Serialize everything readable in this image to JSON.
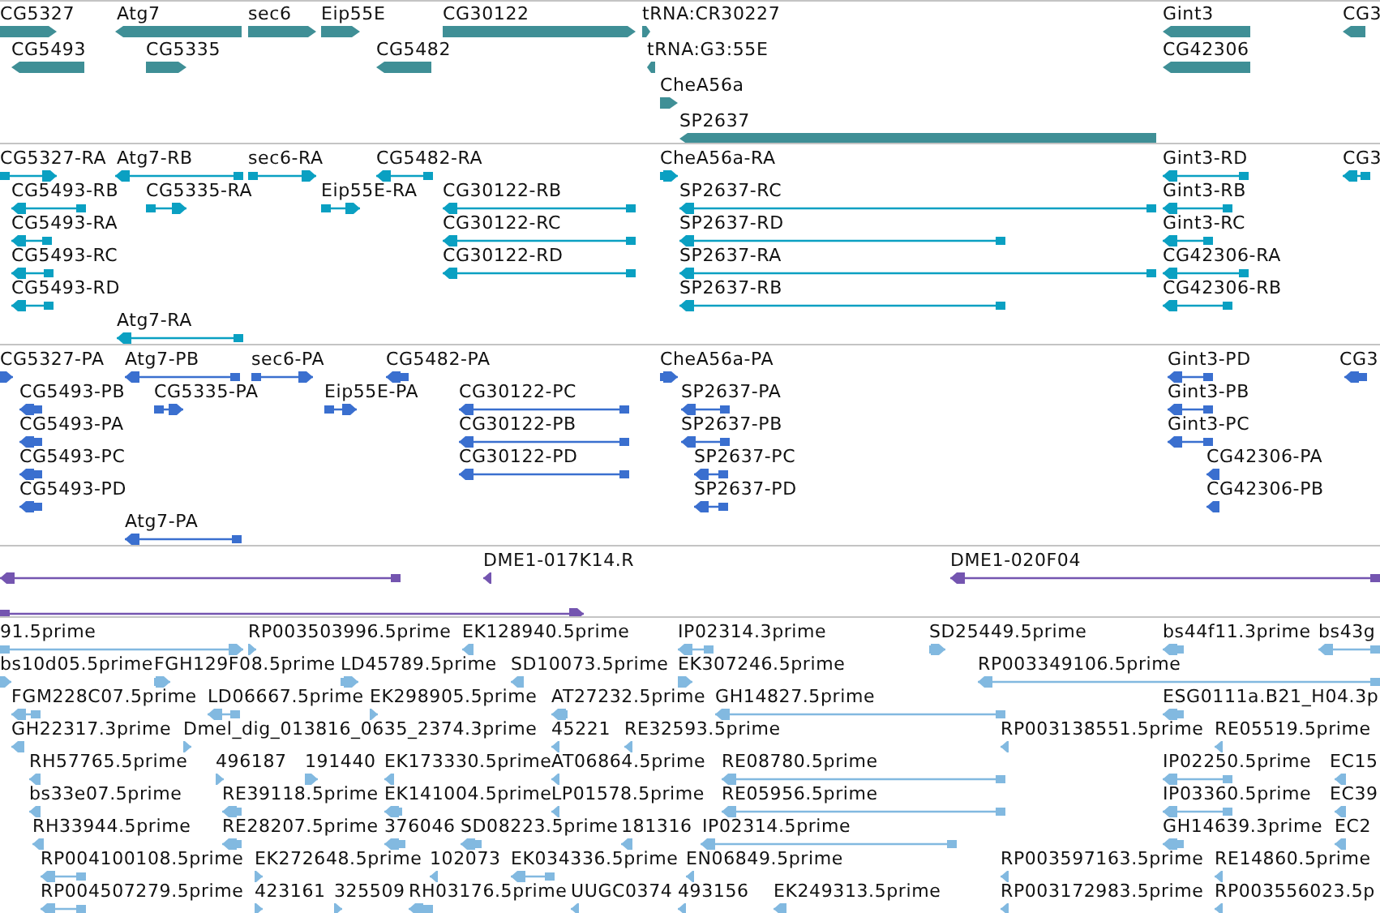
{
  "tracks": [
    {
      "kind": "genes",
      "features": [
        {
          "label": "CG5327",
          "reverse": false
        },
        {
          "label": "Atg7",
          "reverse": true
        },
        {
          "label": "sec6",
          "reverse": false
        },
        {
          "label": "Eip55E",
          "reverse": false
        },
        {
          "label": "CG30122",
          "reverse": false
        },
        {
          "label": "tRNA:CR30227",
          "reverse": false
        },
        {
          "label": "Gint3",
          "reverse": true
        },
        {
          "label": "CG3",
          "reverse": true
        },
        {
          "label": "CG5493",
          "reverse": true
        },
        {
          "label": "CG5335",
          "reverse": false
        },
        {
          "label": "CG5482",
          "reverse": true
        },
        {
          "label": "tRNA:G3:55E",
          "reverse": true
        },
        {
          "label": "CG42306",
          "reverse": true
        },
        {
          "label": "CheA56a",
          "reverse": false
        },
        {
          "label": "SP2637",
          "reverse": true
        }
      ]
    },
    {
      "kind": "transcripts",
      "features": [
        {
          "label": "CG5327-RA",
          "reverse": false
        },
        {
          "label": "Atg7-RB",
          "reverse": true
        },
        {
          "label": "sec6-RA",
          "reverse": false
        },
        {
          "label": "CG5482-RA",
          "reverse": true
        },
        {
          "label": "CheA56a-RA",
          "reverse": false
        },
        {
          "label": "Gint3-RD",
          "reverse": true
        },
        {
          "label": "CG3",
          "reverse": true
        },
        {
          "label": "CG5493-RB",
          "reverse": true
        },
        {
          "label": "CG5335-RA",
          "reverse": false
        },
        {
          "label": "Eip55E-RA",
          "reverse": false
        },
        {
          "label": "CG30122-RB",
          "reverse": true
        },
        {
          "label": "SP2637-RC",
          "reverse": true
        },
        {
          "label": "Gint3-RB",
          "reverse": true
        },
        {
          "label": "CG5493-RA",
          "reverse": true
        },
        {
          "label": "CG30122-RC",
          "reverse": true
        },
        {
          "label": "SP2637-RD",
          "reverse": true
        },
        {
          "label": "Gint3-RC",
          "reverse": true
        },
        {
          "label": "CG5493-RC",
          "reverse": true
        },
        {
          "label": "CG30122-RD",
          "reverse": true
        },
        {
          "label": "SP2637-RA",
          "reverse": true
        },
        {
          "label": "CG42306-RA",
          "reverse": true
        },
        {
          "label": "CG5493-RD",
          "reverse": true
        },
        {
          "label": "SP2637-RB",
          "reverse": true
        },
        {
          "label": "CG42306-RB",
          "reverse": true
        },
        {
          "label": "Atg7-RA",
          "reverse": true
        }
      ]
    },
    {
      "kind": "proteins",
      "features": [
        {
          "label": "CG5327-PA",
          "reverse": false
        },
        {
          "label": "Atg7-PB",
          "reverse": true
        },
        {
          "label": "sec6-PA",
          "reverse": false
        },
        {
          "label": "CG5482-PA",
          "reverse": true
        },
        {
          "label": "CheA56a-PA",
          "reverse": false
        },
        {
          "label": "Gint3-PD",
          "reverse": true
        },
        {
          "label": "CG3",
          "reverse": true
        },
        {
          "label": "CG5493-PB",
          "reverse": true
        },
        {
          "label": "CG5335-PA",
          "reverse": false
        },
        {
          "label": "Eip55E-PA",
          "reverse": false
        },
        {
          "label": "CG30122-PC",
          "reverse": true
        },
        {
          "label": "SP2637-PA",
          "reverse": true
        },
        {
          "label": "Gint3-PB",
          "reverse": true
        },
        {
          "label": "CG5493-PA",
          "reverse": true
        },
        {
          "label": "CG30122-PB",
          "reverse": true
        },
        {
          "label": "SP2637-PB",
          "reverse": true
        },
        {
          "label": "Gint3-PC",
          "reverse": true
        },
        {
          "label": "CG5493-PC",
          "reverse": true
        },
        {
          "label": "CG30122-PD",
          "reverse": true
        },
        {
          "label": "SP2637-PC",
          "reverse": true
        },
        {
          "label": "CG42306-PA",
          "reverse": true
        },
        {
          "label": "CG5493-PD",
          "reverse": true
        },
        {
          "label": "SP2637-PD",
          "reverse": true
        },
        {
          "label": "CG42306-PB",
          "reverse": true
        },
        {
          "label": "Atg7-PA",
          "reverse": true
        }
      ]
    },
    {
      "kind": "clones",
      "features": [
        {
          "reverse": true
        },
        {
          "label": "DME1-017K14.R",
          "reverse": true
        },
        {
          "label": "DME1-020F04",
          "reverse": true
        },
        {
          "reverse": false
        }
      ]
    },
    {
      "kind": "ests",
      "features": [
        {
          "label": "91.5prime",
          "reverse": false
        },
        {
          "label": "RP003503996.5prime",
          "reverse": false
        },
        {
          "label": "EK128940.5prime",
          "reverse": true
        },
        {
          "label": "IP02314.3prime",
          "reverse": true
        },
        {
          "label": "SD25449.5prime",
          "reverse": false
        },
        {
          "label": "bs44f11.3prime",
          "reverse": true
        },
        {
          "label": "bs43g",
          "reverse": true
        },
        {
          "label": "bs10d05.5prime",
          "reverse": false
        },
        {
          "label": "FGH129F08.5prime",
          "reverse": false
        },
        {
          "label": "LD45789.5prime",
          "reverse": false
        },
        {
          "label": "SD10073.5prime",
          "reverse": true
        },
        {
          "label": "EK307246.5prime",
          "reverse": false
        },
        {
          "label": "RP003349106.5prime",
          "reverse": true
        },
        {
          "label": "FGM228C07.5prime",
          "reverse": true
        },
        {
          "label": "LD06667.5prime",
          "reverse": true
        },
        {
          "label": "EK298905.5prime",
          "reverse": false
        },
        {
          "label": "AT27232.5prime",
          "reverse": true
        },
        {
          "label": "GH14827.5prime",
          "reverse": true
        },
        {
          "label": "ESG0111a.B21_H04.3p",
          "reverse": true
        },
        {
          "label": "GH22317.3prime",
          "reverse": true
        },
        {
          "label": "Dmel_dig_013816_0635_2374.3prime",
          "reverse": false
        },
        {
          "label": "45221",
          "reverse": true
        },
        {
          "label": "RE32593.5prime",
          "reverse": true
        },
        {
          "label": "RP003138551.5prime",
          "reverse": true
        },
        {
          "label": "RE05519.5prime",
          "reverse": true
        },
        {
          "label": "RH57765.5prime",
          "reverse": true
        },
        {
          "label": "496187",
          "reverse": false
        },
        {
          "label": "191440",
          "reverse": false
        },
        {
          "label": "EK173330.5prime",
          "reverse": true
        },
        {
          "label": "AT06864.5prime",
          "reverse": true
        },
        {
          "label": "RE08780.5prime",
          "reverse": true
        },
        {
          "label": "IP02250.5prime",
          "reverse": true
        },
        {
          "label": "EC15",
          "reverse": true
        },
        {
          "label": "bs33e07.5prime",
          "reverse": true
        },
        {
          "label": "RE39118.5prime",
          "reverse": true
        },
        {
          "label": "EK141004.5prime",
          "reverse": true
        },
        {
          "label": "LP01578.5prime",
          "reverse": true
        },
        {
          "label": "RE05956.5prime",
          "reverse": true
        },
        {
          "label": "IP03360.5prime",
          "reverse": true
        },
        {
          "label": "EC39",
          "reverse": true
        },
        {
          "label": "RH33944.5prime",
          "reverse": true
        },
        {
          "label": "RE28207.5prime",
          "reverse": true
        },
        {
          "label": "376046",
          "reverse": true
        },
        {
          "label": "SD08223.5prime",
          "reverse": true
        },
        {
          "label": "181316",
          "reverse": true
        },
        {
          "label": "IP02314.5prime",
          "reverse": true
        },
        {
          "label": "GH14639.3prime",
          "reverse": true
        },
        {
          "label": "EC2",
          "reverse": true
        },
        {
          "label": "RP004100108.5prime",
          "reverse": true
        },
        {
          "label": "EK272648.5prime",
          "reverse": false
        },
        {
          "label": "102073",
          "reverse": true
        },
        {
          "label": "EK034336.5prime",
          "reverse": true
        },
        {
          "label": "EN06849.5prime",
          "reverse": true
        },
        {
          "label": "RP003597163.5prime",
          "reverse": true
        },
        {
          "label": "RE14860.5prime",
          "reverse": true
        },
        {
          "label": "RP004507279.5prime",
          "reverse": true
        },
        {
          "label": "423161",
          "reverse": false
        },
        {
          "label": "325509",
          "reverse": false
        },
        {
          "label": "RH03176.5prime",
          "reverse": true
        },
        {
          "label": "UUGC0374",
          "reverse": true
        },
        {
          "label": "493156",
          "reverse": true
        },
        {
          "label": "EK249313.5prime",
          "reverse": true
        },
        {
          "label": "RP003172983.5prime",
          "reverse": true
        },
        {
          "label": "RP003556023.5p",
          "reverse": true
        }
      ]
    }
  ]
}
